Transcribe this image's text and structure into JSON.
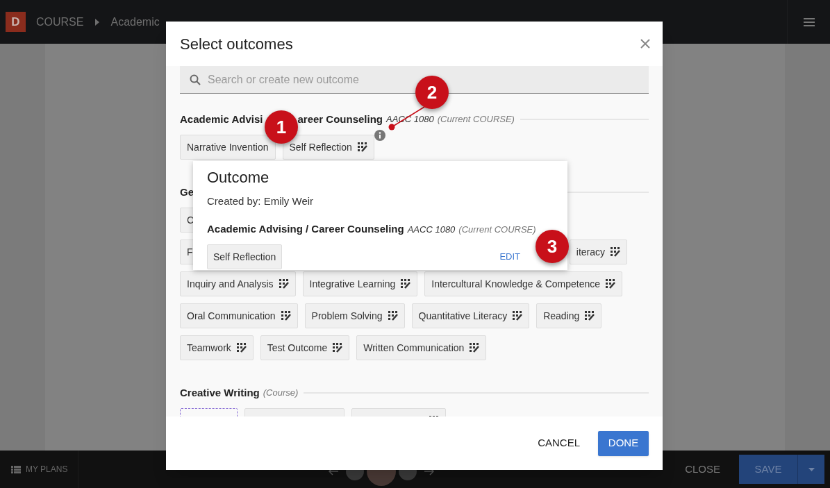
{
  "top_bar": {
    "logo": "D",
    "breadcrumb": [
      {
        "label": "COURSE"
      },
      {
        "label": "Academic"
      }
    ]
  },
  "bottom_bar": {
    "my_plans": "MY PLANS",
    "close": "CLOSE",
    "save": "SAVE"
  },
  "dialog": {
    "title": "Select outcomes",
    "search": {
      "placeholder": "Search or create new outcome"
    },
    "sections": [
      {
        "title_parts": [
          "Academic Advisi",
          "areer Counseling"
        ],
        "code": "AACC 1080",
        "note": "(Current COURSE)",
        "rows": [
          [
            {
              "kind": "plain",
              "label": "Narrative Invention"
            },
            {
              "kind": "rubric",
              "label": "Self Reflection"
            }
          ]
        ]
      },
      {
        "title_parts": [
          "Ge"
        ],
        "rows": [
          [
            {
              "kind": "plain",
              "label": "C"
            }
          ],
          [
            {
              "kind": "plain",
              "label": "F"
            },
            {
              "kind": "rubric",
              "label": "iteracy"
            }
          ],
          [
            {
              "kind": "rubric",
              "label": "Inquiry and Analysis"
            },
            {
              "kind": "rubric",
              "label": "Integrative Learning"
            },
            {
              "kind": "rubric",
              "label": "Intercultural Knowledge & Competence"
            }
          ],
          [
            {
              "kind": "rubric",
              "label": "Oral Communication"
            },
            {
              "kind": "rubric",
              "label": "Problem Solving"
            },
            {
              "kind": "rubric",
              "label": "Quantitative Literacy"
            },
            {
              "kind": "rubric",
              "label": "Reading"
            }
          ],
          [
            {
              "kind": "rubric",
              "label": "Teamwork"
            },
            {
              "kind": "rubric",
              "label": "Test Outcome"
            },
            {
              "kind": "rubric",
              "label": "Written Communication"
            }
          ]
        ]
      },
      {
        "title_parts": [
          "Creative Writing"
        ],
        "note": "(Course)",
        "rows": [
          [
            {
              "kind": "dashed"
            },
            {
              "kind": "plain"
            },
            {
              "kind": "rubric"
            }
          ]
        ]
      }
    ],
    "popover": {
      "title": "Outcome",
      "created_by": "Created by: Emily Weir",
      "course": "Academic Advising / Career Counseling",
      "code": "AACC 1080",
      "note": "(Current COURSE)",
      "chip": "Self Reflection",
      "edit": "EDIT"
    },
    "cancel": "CANCEL",
    "done": "DONE"
  },
  "callouts": [
    {
      "label": "1"
    },
    {
      "label": "2"
    },
    {
      "label": "3"
    }
  ]
}
